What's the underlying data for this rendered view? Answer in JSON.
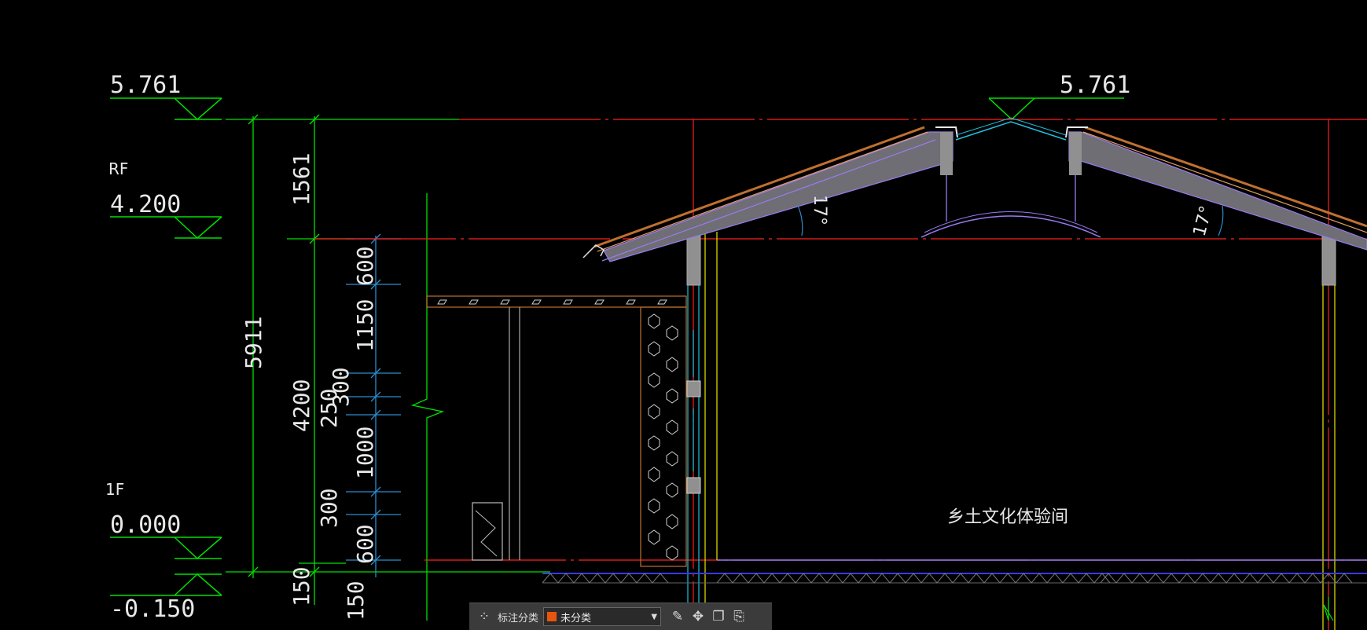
{
  "drawing": {
    "levels": [
      {
        "id": "top-left",
        "value": "5.761"
      },
      {
        "id": "top-right",
        "value": "5.761"
      },
      {
        "id": "rf",
        "label": "RF",
        "value": "4.200"
      },
      {
        "id": "1f",
        "label": "1F",
        "value": "0.000"
      },
      {
        "id": "ground",
        "value": "-0.150"
      }
    ],
    "dimensions": {
      "total": "5911",
      "roof": "1561",
      "floor": "4200",
      "base": "150",
      "segments": [
        "600",
        "1150",
        "300",
        "250",
        "1000",
        "300",
        "600",
        "150"
      ]
    },
    "angles": [
      "17°",
      "17°"
    ],
    "room_label": "乡土文化体验间"
  },
  "toolbar": {
    "category_label": "标注分类",
    "selected_category": "未分类",
    "swatch_color": "#e8550f"
  },
  "colors": {
    "green": "#00e000",
    "red": "#ff2020",
    "cyan": "#20c0e0",
    "purple": "#9a7af0",
    "yellow": "#e8e800",
    "brown": "#c07030"
  }
}
